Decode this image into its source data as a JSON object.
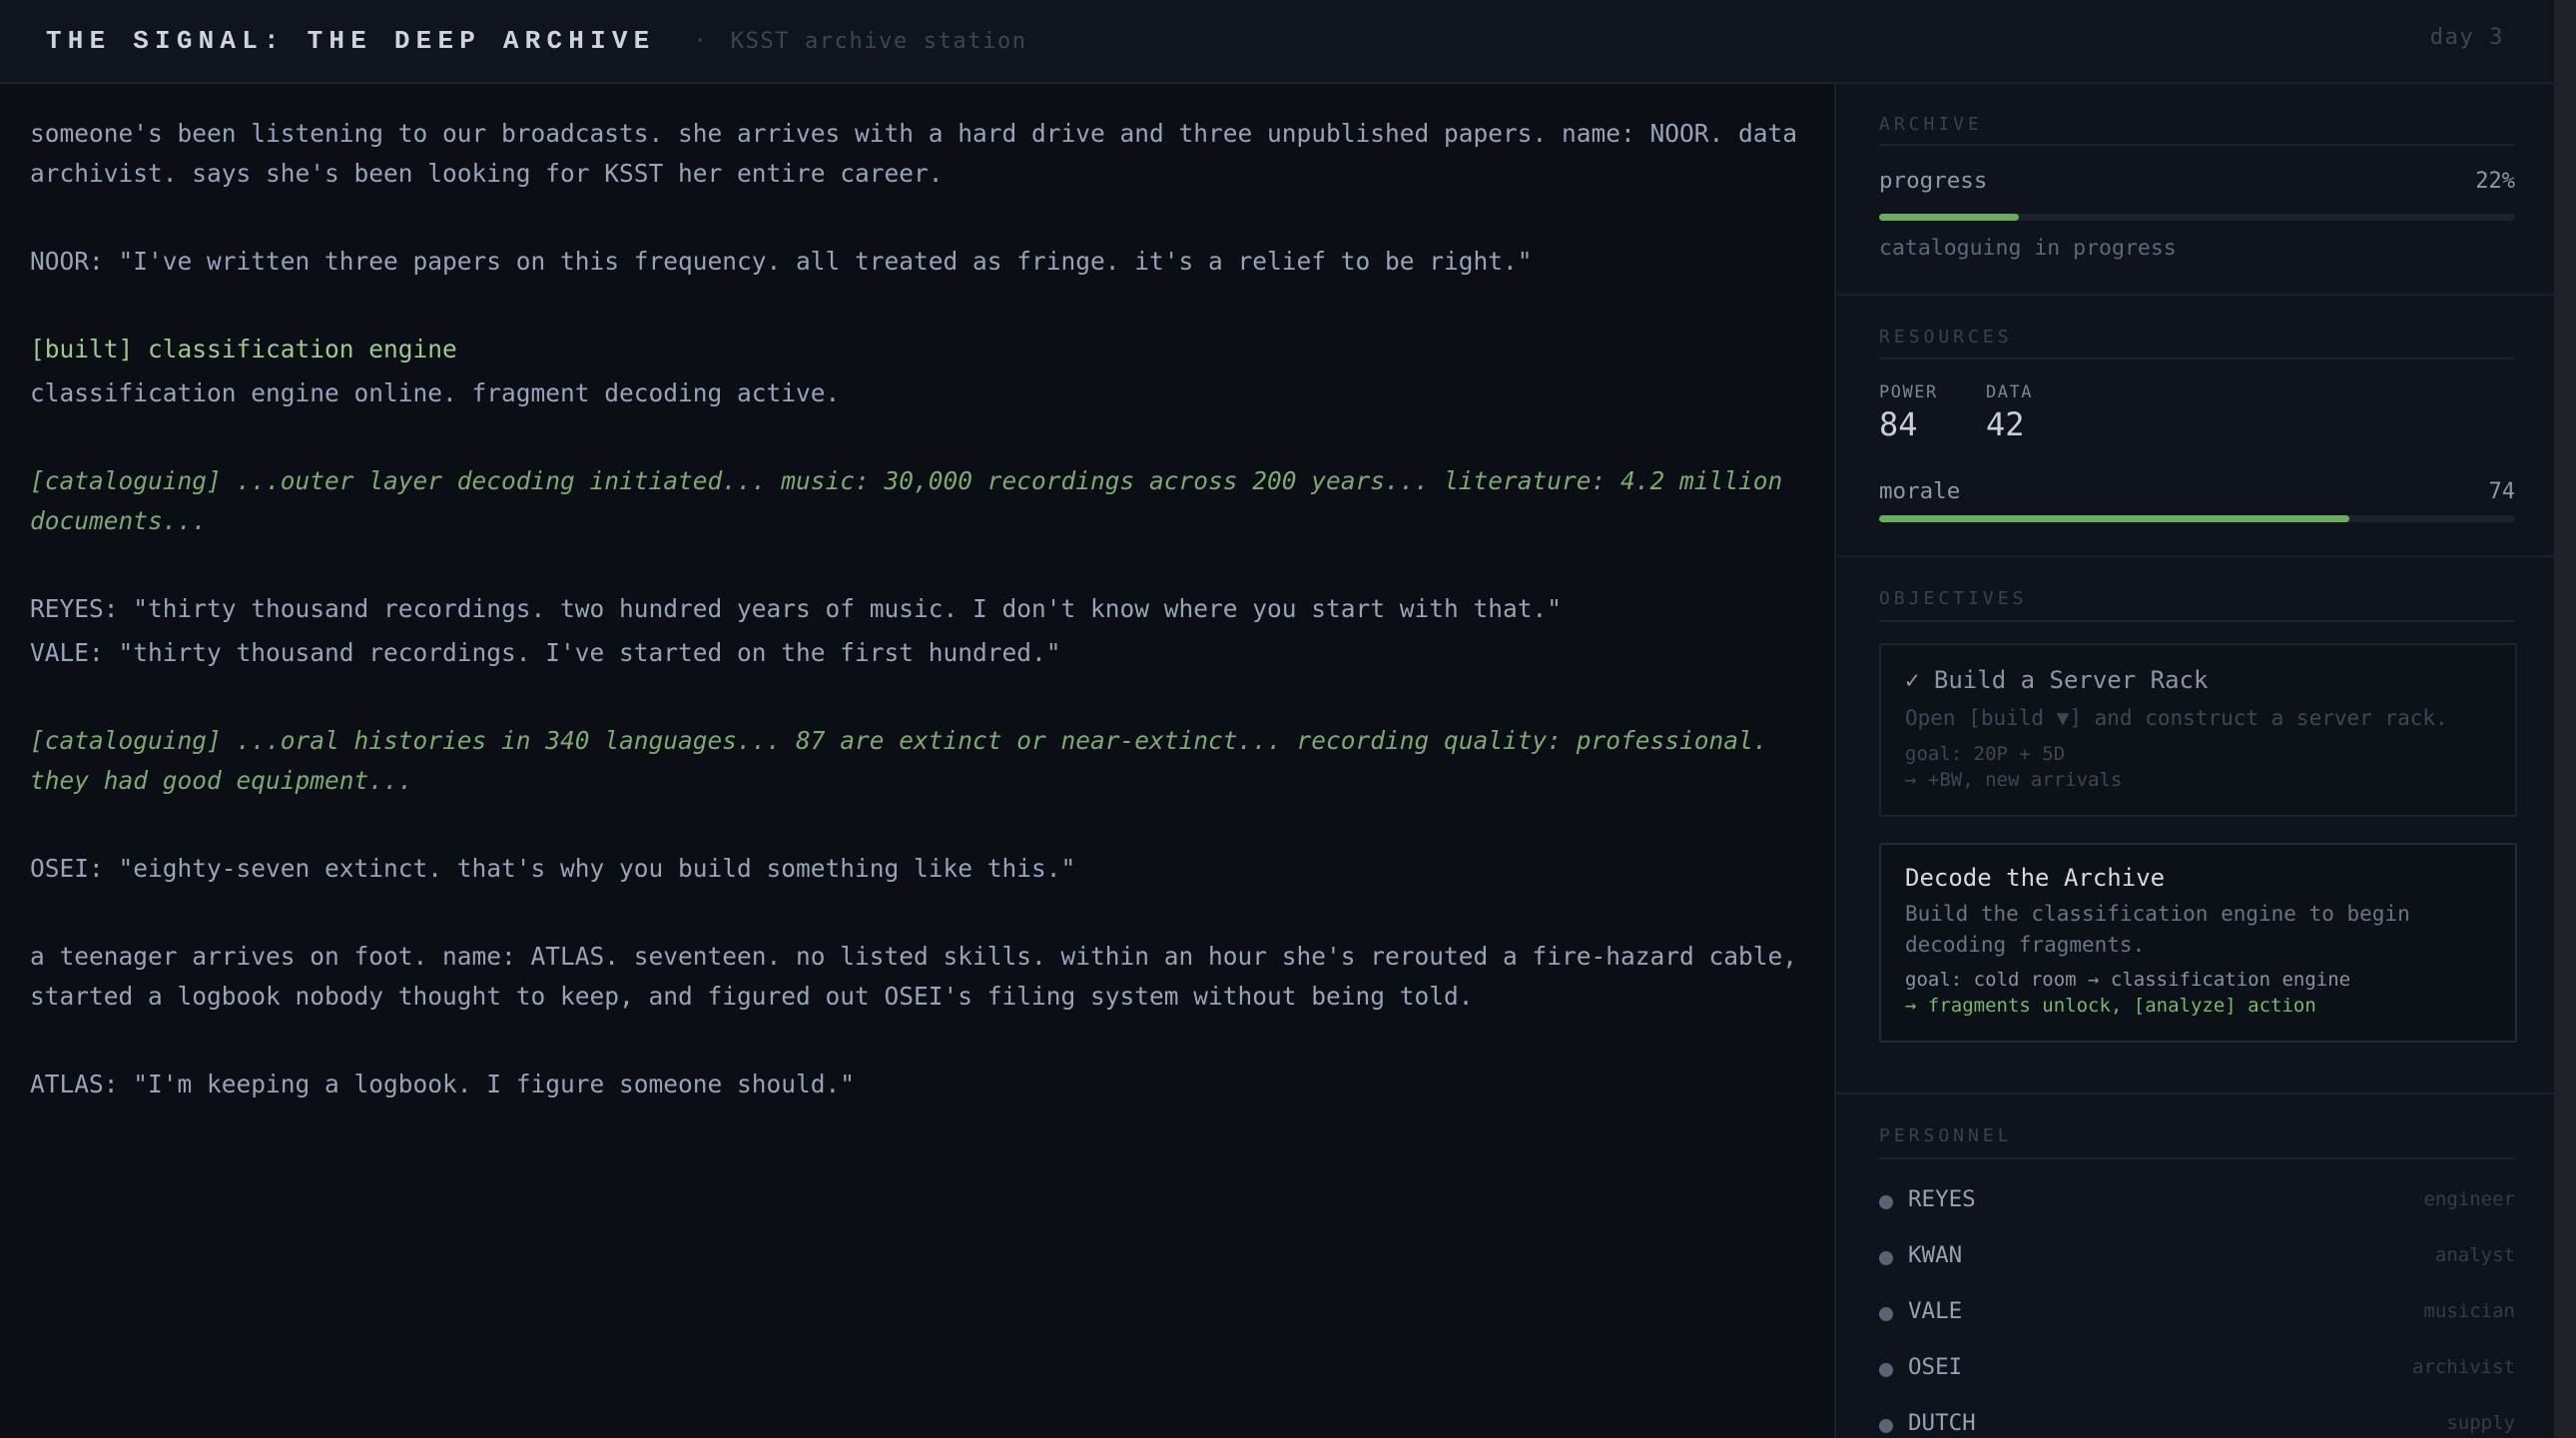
{
  "header": {
    "title": "THE SIGNAL: THE DEEP ARCHIVE",
    "separator": "·",
    "subtitle": "KSST archive station",
    "day": "day 3"
  },
  "log": [
    {
      "type": "narration",
      "text": "someone's been listening to our broadcasts. she arrives with a hard drive and three unpublished papers. name: NOOR. data archivist. says she's been looking for KSST her entire career."
    },
    {
      "type": "dialogue",
      "text": "NOOR: \"I've written three papers on this frequency. all treated as fringe. it's a relief to be right.\""
    },
    {
      "type": "built",
      "text": "[built] classification engine"
    },
    {
      "type": "narration",
      "text": "classification engine online. fragment decoding active."
    },
    {
      "type": "cataloguing",
      "text": "[cataloguing] ...outer layer decoding initiated... music: 30,000 recordings across 200 years... literature: 4.2 million documents..."
    },
    {
      "type": "dialogue",
      "text": "REYES: \"thirty thousand recordings. two hundred years of music. I don't know where you start with that.\""
    },
    {
      "type": "dialogue",
      "text": "VALE: \"thirty thousand recordings. I've started on the first hundred.\""
    },
    {
      "type": "cataloguing",
      "text": "[cataloguing] ...oral histories in 340 languages... 87 are extinct or near-extinct... recording quality: professional. they had good equipment..."
    },
    {
      "type": "dialogue",
      "text": "OSEI: \"eighty-seven extinct. that's why you build something like this.\""
    },
    {
      "type": "narration",
      "text": "a teenager arrives on foot. name: ATLAS. seventeen. no listed skills. within an hour she's rerouted a fire-hazard cable, started a logbook nobody thought to keep, and figured out OSEI's filing system without being told."
    },
    {
      "type": "dialogue",
      "text": "ATLAS: \"I'm keeping a logbook. I figure someone should.\""
    }
  ],
  "archive": {
    "label": "ARCHIVE",
    "progress_label": "progress",
    "progress_value": "22%",
    "progress_fraction": 0.22,
    "status": "cataloguing in progress"
  },
  "resources": {
    "label": "RESOURCES",
    "power_label": "POWER",
    "power_value": "84",
    "data_label": "DATA",
    "data_value": "42",
    "morale_label": "morale",
    "morale_value": "74",
    "morale_fraction": 0.74
  },
  "objectives": {
    "label": "OBJECTIVES",
    "items": [
      {
        "check": "✓",
        "title": "Build a Server Rack",
        "desc": "Open [build ▼] and construct a server rack.",
        "goal": "goal: 20P + 5D",
        "reward": "→ +BW, new arrivals"
      },
      {
        "title": "Decode the Archive",
        "desc": "Build the classification engine to begin decoding fragments.",
        "goal": "goal: cold room → classification engine",
        "reward": "→ fragments unlock, [analyze] action"
      }
    ]
  },
  "personnel": {
    "label": "PERSONNEL",
    "members": [
      {
        "name": "REYES",
        "role": "engineer"
      },
      {
        "name": "KWAN",
        "role": "analyst"
      },
      {
        "name": "VALE",
        "role": "musician"
      },
      {
        "name": "OSEI",
        "role": "archivist"
      },
      {
        "name": "DUTCH",
        "role": "supply"
      }
    ]
  },
  "colors": {
    "accent_green": "#6bab62",
    "background": "#0b0e14",
    "panel": "#0f131b"
  }
}
